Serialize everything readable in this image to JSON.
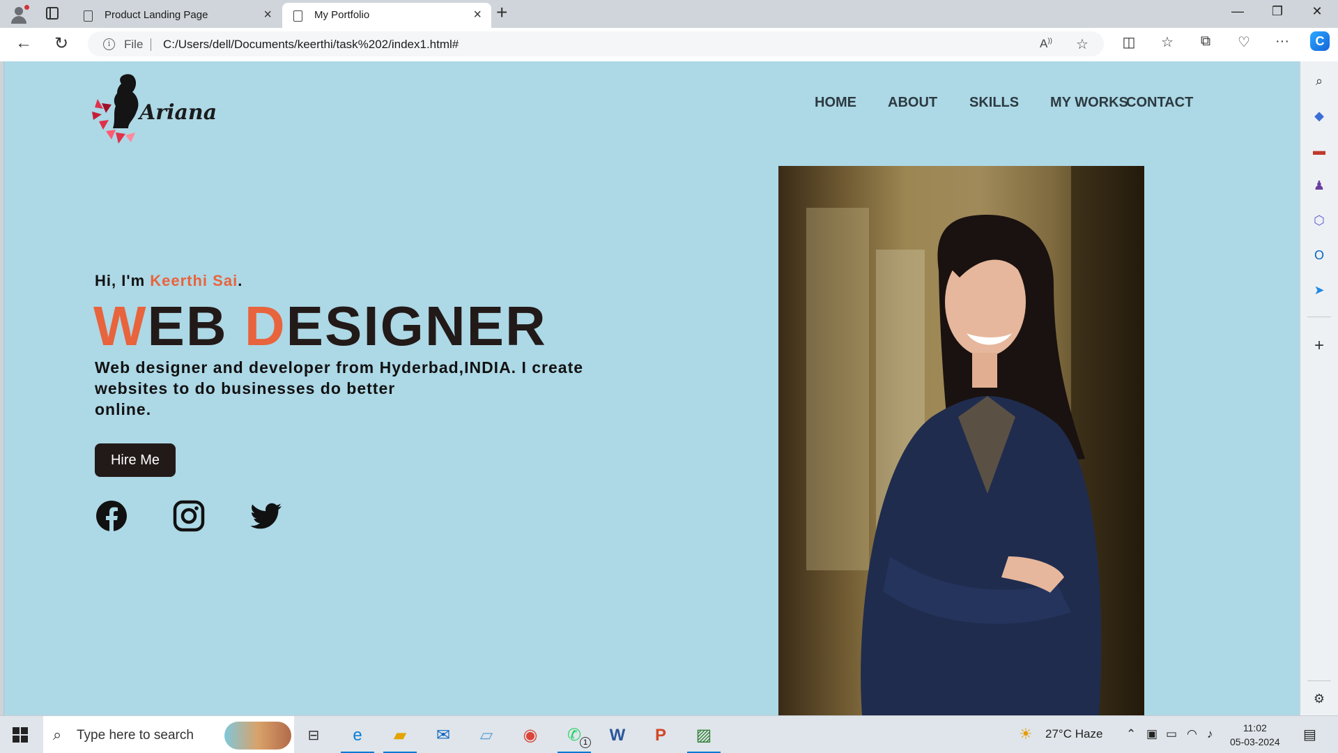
{
  "browser": {
    "tabs": [
      {
        "title": "Product Landing Page",
        "active": false
      },
      {
        "title": "My Portfolio",
        "active": true
      }
    ],
    "address": {
      "scheme_label": "File",
      "url": "C:/Users/dell/Documents/keerthi/task%202/index1.html#"
    }
  },
  "site": {
    "logo_text": "Ariana",
    "nav": [
      "HOME",
      "ABOUT",
      "SKILLS",
      "MY WORKS",
      "CONTACT"
    ],
    "hero": {
      "greeting_prefix": "Hi, I'm ",
      "greeting_name": "Keerthi Sai",
      "greeting_suffix": ".",
      "headline": {
        "w1_first": "W",
        "w1_rest": "EB ",
        "w2_first": "D",
        "w2_rest": "ESIGNER"
      },
      "bio": [
        "Web designer and developer from Hyderbad,INDIA. I create",
        "websites to do businesses do better",
        "online."
      ],
      "button": "Hire Me"
    },
    "social": [
      "facebook-icon",
      "instagram-icon",
      "twitter-icon"
    ],
    "colors": {
      "background": "#add8e6",
      "accent": "#e8643c",
      "dark": "#221a18"
    }
  },
  "taskbar": {
    "search_placeholder": "Type here to search",
    "weather": "27°C  Haze",
    "time": "11:02",
    "date": "05-03-2024",
    "whatsapp_badge": "1"
  }
}
